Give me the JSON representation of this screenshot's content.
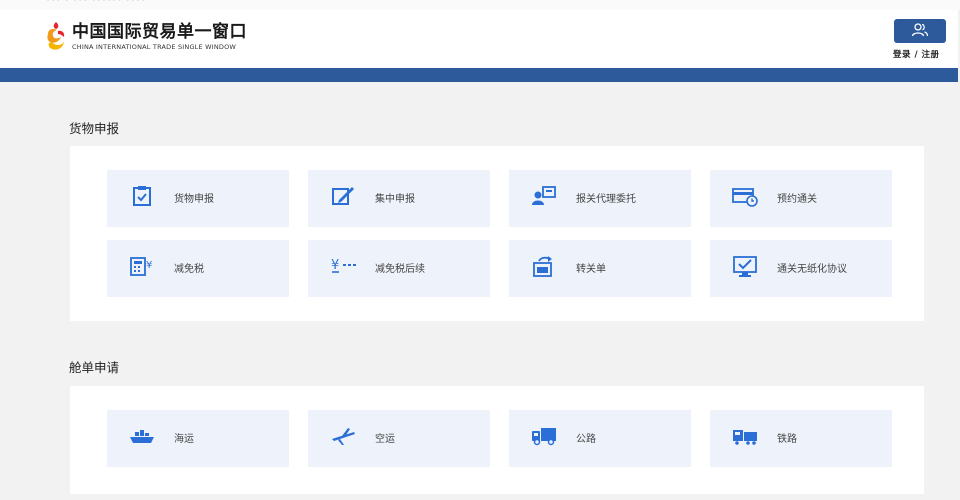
{
  "header": {
    "breadcrumb": "••• • ••• •••••• ••••",
    "logo_cn": "中国国际贸易单一窗口",
    "logo_en": "CHINA INTERNATIONAL TRADE SINGLE WINDOW",
    "login_label": "登录 / 注册",
    "login_icon": "users-icon"
  },
  "colors": {
    "brand_blue": "#2d5a9a",
    "tile_bg": "#eef3fb",
    "icon_blue": "#2b6fd6",
    "page_bg": "#f2f2f2"
  },
  "sections": [
    {
      "title": "货物申报",
      "tiles": [
        {
          "label": "货物申报",
          "icon": "clipboard-check-icon"
        },
        {
          "label": "集中申报",
          "icon": "pen-edit-icon"
        },
        {
          "label": "报关代理委托",
          "icon": "agent-id-icon"
        },
        {
          "label": "预约通关",
          "icon": "card-clock-icon"
        },
        {
          "label": "减免税",
          "icon": "calculator-icon"
        },
        {
          "label": "减免税后续",
          "icon": "tax-followup-icon"
        },
        {
          "label": "转关单",
          "icon": "transfer-document-icon"
        },
        {
          "label": "通关无纸化协议",
          "icon": "monitor-check-icon"
        }
      ]
    },
    {
      "title": "舱单申请",
      "tiles": [
        {
          "label": "海运",
          "icon": "ship-icon"
        },
        {
          "label": "空运",
          "icon": "airplane-icon"
        },
        {
          "label": "公路",
          "icon": "truck-icon"
        },
        {
          "label": "铁路",
          "icon": "train-icon"
        }
      ]
    }
  ]
}
